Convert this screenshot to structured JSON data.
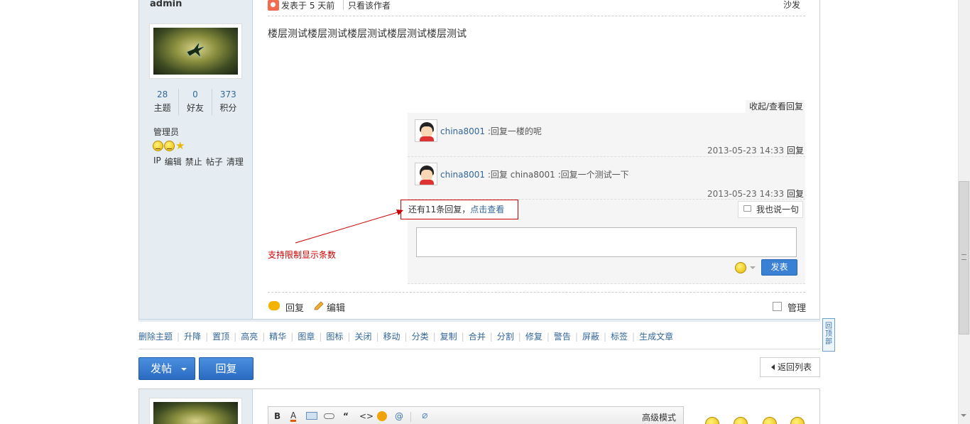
{
  "author": {
    "name": "admin",
    "stats": [
      {
        "value": "28",
        "label": "主题"
      },
      {
        "value": "0",
        "label": "好友"
      },
      {
        "value": "373",
        "label": "积分"
      }
    ],
    "role": "管理员",
    "admin_links": [
      "IP",
      "编辑",
      "禁止",
      "帖子",
      "清理"
    ]
  },
  "post": {
    "posted": "发表于 5 天前",
    "only_author": "只看该作者",
    "floor": "沙发",
    "body": "楼层测试楼层测试楼层测试楼层测试楼层测试"
  },
  "comments": {
    "toggle": "收起/查看回复",
    "items": [
      {
        "user": "china8001",
        "text": ":回复一楼的呢",
        "time": "2013-05-23 14:33",
        "reply": "回复"
      },
      {
        "user": "china8001",
        "text": ":回复 china8001 :回复一个测试一下",
        "time": "2013-05-23 14:33",
        "reply": "回复"
      }
    ],
    "more_prefix": "还有11条回复，",
    "more_link": "点击查看",
    "say_button": "我也说一句",
    "submit": "发表"
  },
  "annotation": "支持限制显示条数",
  "post_footer": {
    "reply": "回复",
    "edit": "编辑",
    "manage": "管理"
  },
  "mod_actions": [
    "删除主题",
    "升降",
    "置顶",
    "高亮",
    "精华",
    "图章",
    "图标",
    "关闭",
    "移动",
    "分类",
    "复制",
    "合并",
    "分割",
    "修复",
    "警告",
    "屏蔽",
    "标签",
    "生成文章"
  ],
  "buttons": {
    "new_post": "发帖",
    "reply": "回复",
    "back_to_list": "返回列表"
  },
  "back_to_top": "回顶部",
  "editor": {
    "bold": "B",
    "font_color": "A",
    "quote": "“",
    "code": "<>",
    "at": "@",
    "advanced": "高级模式"
  },
  "colors": {
    "link": "#336699",
    "accent_button": "#3a80d4",
    "sidebar": "#e5edf2",
    "annotation": "#cc0000"
  }
}
